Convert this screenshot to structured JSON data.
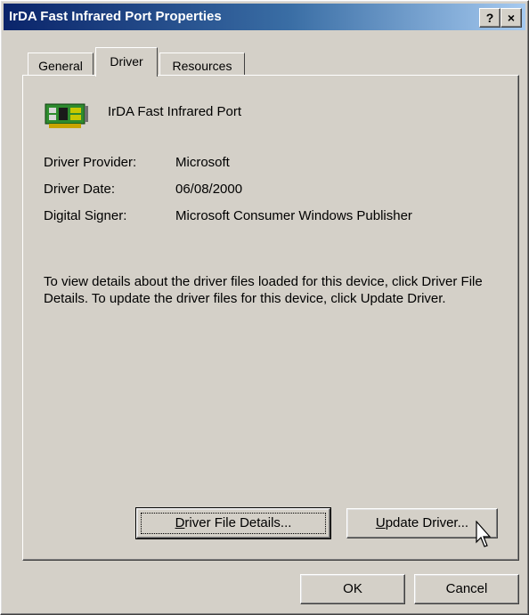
{
  "window": {
    "title": "IrDA Fast Infrared Port Properties",
    "help_button": "?",
    "close_button": "×"
  },
  "tabs": [
    {
      "label": "General",
      "active": false
    },
    {
      "label": "Driver",
      "active": true
    },
    {
      "label": "Resources",
      "active": false
    }
  ],
  "device": {
    "name": "IrDA Fast Infrared Port",
    "icon": "network-card-icon"
  },
  "driver_info": {
    "provider_label": "Driver Provider:",
    "provider_value": "Microsoft",
    "date_label": "Driver Date:",
    "date_value": "06/08/2000",
    "signer_label": "Digital Signer:",
    "signer_value": "Microsoft Consumer Windows Publisher"
  },
  "description": "To view details about the driver files loaded for this device, click Driver File Details.  To update the driver files for this device, click Update Driver.",
  "buttons": {
    "details_mnemonic": "D",
    "details_rest": "river File Details...",
    "update_mnemonic": "U",
    "update_rest": "pdate Driver...",
    "ok": "OK",
    "cancel": "Cancel"
  }
}
